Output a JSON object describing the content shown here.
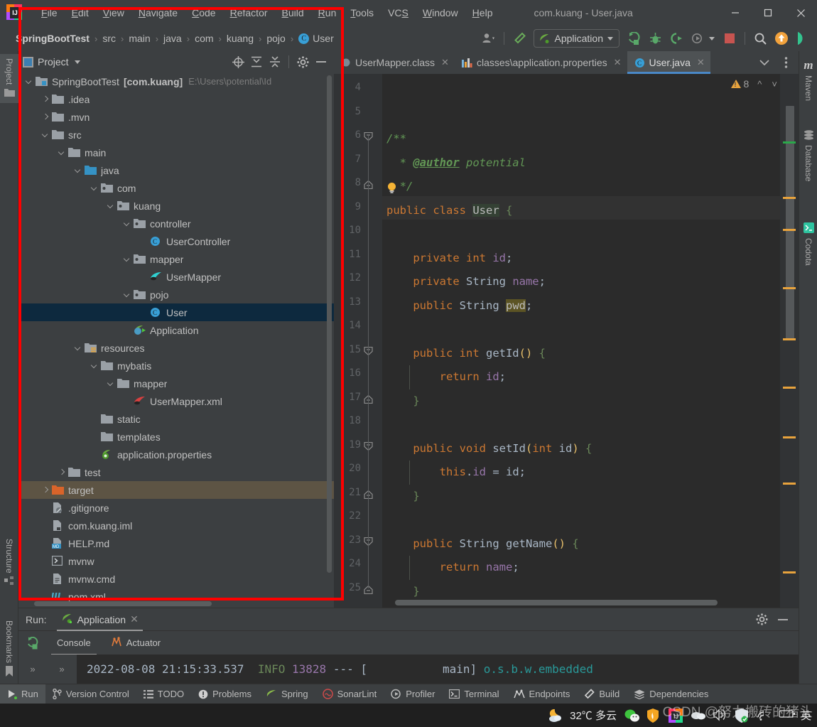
{
  "titlebar": {
    "menus": [
      "File",
      "Edit",
      "View",
      "Navigate",
      "Code",
      "Refactor",
      "Build",
      "Run",
      "Tools",
      "VCS",
      "Window",
      "Help"
    ],
    "window_title": "com.kuang - User.java",
    "minimize": "–",
    "maximize": "□",
    "close": "✕"
  },
  "navbar": {
    "crumbs": [
      "SpringBootTest",
      "src",
      "main",
      "java",
      "com",
      "kuang",
      "pojo"
    ],
    "leaf": "User",
    "separator": "›",
    "run_config": "Application"
  },
  "left_strip": {
    "project": "Project",
    "structure": "Structure",
    "bookmarks": "Bookmarks"
  },
  "right_strip": {
    "maven": "Maven",
    "database": "Database",
    "codota": "Codota"
  },
  "project_panel": {
    "title": "Project",
    "tree": [
      {
        "label": "SpringBootTest",
        "bold_suffix": "[com.kuang]",
        "path": "E:\\Users\\potential\\Id",
        "depth": 0,
        "arrow": "down",
        "icon": "module-folder",
        "state": "normal"
      },
      {
        "label": ".idea",
        "depth": 1,
        "arrow": "right",
        "icon": "folder",
        "state": "normal"
      },
      {
        "label": ".mvn",
        "depth": 1,
        "arrow": "right",
        "icon": "folder",
        "state": "normal"
      },
      {
        "label": "src",
        "depth": 1,
        "arrow": "down",
        "icon": "folder",
        "state": "normal"
      },
      {
        "label": "main",
        "depth": 2,
        "arrow": "down",
        "icon": "folder",
        "state": "normal"
      },
      {
        "label": "java",
        "depth": 3,
        "arrow": "down",
        "icon": "source-folder",
        "state": "normal"
      },
      {
        "label": "com",
        "depth": 4,
        "arrow": "down",
        "icon": "package",
        "state": "normal"
      },
      {
        "label": "kuang",
        "depth": 5,
        "arrow": "down",
        "icon": "package",
        "state": "normal"
      },
      {
        "label": "controller",
        "depth": 6,
        "arrow": "down",
        "icon": "package",
        "state": "normal"
      },
      {
        "label": "UserController",
        "depth": 7,
        "arrow": "none",
        "icon": "class",
        "state": "normal"
      },
      {
        "label": "mapper",
        "depth": 6,
        "arrow": "down",
        "icon": "package",
        "state": "normal"
      },
      {
        "label": "UserMapper",
        "depth": 7,
        "arrow": "none",
        "icon": "mybatis",
        "state": "normal"
      },
      {
        "label": "pojo",
        "depth": 6,
        "arrow": "down",
        "icon": "package",
        "state": "normal"
      },
      {
        "label": "User",
        "depth": 7,
        "arrow": "none",
        "icon": "class",
        "state": "selected"
      },
      {
        "label": "Application",
        "depth": 6,
        "arrow": "none",
        "icon": "spring-run",
        "state": "normal"
      },
      {
        "label": "resources",
        "depth": 3,
        "arrow": "down",
        "icon": "resources-folder",
        "state": "normal"
      },
      {
        "label": "mybatis",
        "depth": 4,
        "arrow": "down",
        "icon": "folder",
        "state": "normal"
      },
      {
        "label": "mapper",
        "depth": 5,
        "arrow": "down",
        "icon": "folder",
        "state": "normal"
      },
      {
        "label": "UserMapper.xml",
        "depth": 6,
        "arrow": "none",
        "icon": "mybatis-xml",
        "state": "normal"
      },
      {
        "label": "static",
        "depth": 4,
        "arrow": "none",
        "icon": "folder",
        "state": "normal"
      },
      {
        "label": "templates",
        "depth": 4,
        "arrow": "none",
        "icon": "folder",
        "state": "normal"
      },
      {
        "label": "application.properties",
        "depth": 4,
        "arrow": "none",
        "icon": "spring-props",
        "state": "normal"
      },
      {
        "label": "test",
        "depth": 2,
        "arrow": "right",
        "icon": "folder",
        "state": "normal"
      },
      {
        "label": "target",
        "depth": 1,
        "arrow": "right",
        "icon": "excluded-folder",
        "state": "target"
      },
      {
        "label": ".gitignore",
        "depth": 1,
        "arrow": "none",
        "icon": "gitignore",
        "state": "normal"
      },
      {
        "label": "com.kuang.iml",
        "depth": 1,
        "arrow": "none",
        "icon": "iml",
        "state": "normal"
      },
      {
        "label": "HELP.md",
        "depth": 1,
        "arrow": "none",
        "icon": "markdown",
        "state": "normal"
      },
      {
        "label": "mvnw",
        "depth": 1,
        "arrow": "none",
        "icon": "shell",
        "state": "normal"
      },
      {
        "label": "mvnw.cmd",
        "depth": 1,
        "arrow": "none",
        "icon": "text",
        "state": "normal"
      },
      {
        "label": "pom.xml",
        "depth": 1,
        "arrow": "none",
        "icon": "maven-pom",
        "state": "normal"
      }
    ]
  },
  "editor": {
    "tabs": [
      {
        "label": "UserMapper.class",
        "icon": "class-file",
        "active": false
      },
      {
        "label": "classes\\application.properties",
        "icon": "properties-file",
        "active": false
      },
      {
        "label": "User.java",
        "icon": "java-class",
        "active": true
      }
    ],
    "warning_count": "8",
    "lines": [
      {
        "no": "4",
        "tokens": []
      },
      {
        "no": "5",
        "tokens": []
      },
      {
        "no": "6",
        "tokens": [
          {
            "t": "/**",
            "c": "cm"
          }
        ],
        "fold": "open"
      },
      {
        "no": "7",
        "tokens": [
          {
            "t": "  * ",
            "c": "cm"
          },
          {
            "t": "@author",
            "c": "cmtag"
          },
          {
            "t": " potential",
            "c": "cm"
          }
        ]
      },
      {
        "no": "8",
        "tokens": [
          {
            "t": "  */",
            "c": "cm"
          }
        ],
        "fold": "end",
        "bulb": true
      },
      {
        "no": "9",
        "tokens": [
          {
            "t": "public ",
            "c": "k"
          },
          {
            "t": "class ",
            "c": "k"
          },
          {
            "t": "User",
            "c": "sel-ident"
          },
          {
            "t": " {",
            "c": "brc"
          }
        ],
        "highlight": true
      },
      {
        "no": "10",
        "tokens": []
      },
      {
        "no": "11",
        "tokens": [
          {
            "t": "    ",
            "c": "pun"
          },
          {
            "t": "private int ",
            "c": "k"
          },
          {
            "t": "id",
            "c": "fld"
          },
          {
            "t": ";",
            "c": "pun"
          }
        ]
      },
      {
        "no": "12",
        "tokens": [
          {
            "t": "    ",
            "c": "pun"
          },
          {
            "t": "private ",
            "c": "k"
          },
          {
            "t": "String ",
            "c": "typ"
          },
          {
            "t": "name",
            "c": "fld"
          },
          {
            "t": ";",
            "c": "pun"
          }
        ]
      },
      {
        "no": "13",
        "tokens": [
          {
            "t": "    ",
            "c": "pun"
          },
          {
            "t": "public ",
            "c": "k"
          },
          {
            "t": "String ",
            "c": "typ"
          },
          {
            "t": "pwd",
            "c": "sel-pwd"
          },
          {
            "t": ";",
            "c": "pun"
          }
        ]
      },
      {
        "no": "14",
        "tokens": []
      },
      {
        "no": "15",
        "tokens": [
          {
            "t": "    ",
            "c": "pun"
          },
          {
            "t": "public int ",
            "c": "k"
          },
          {
            "t": "getId",
            "c": "typ"
          },
          {
            "t": "()",
            "c": "par"
          },
          {
            "t": " {",
            "c": "brc"
          }
        ],
        "fold": "open"
      },
      {
        "no": "16",
        "tokens": [
          {
            "t": "        ",
            "c": "pun"
          },
          {
            "t": "return ",
            "c": "k"
          },
          {
            "t": "id",
            "c": "fld"
          },
          {
            "t": ";",
            "c": "pun"
          }
        ]
      },
      {
        "no": "17",
        "tokens": [
          {
            "t": "    ",
            "c": "pun"
          },
          {
            "t": "}",
            "c": "brc"
          }
        ],
        "fold": "end"
      },
      {
        "no": "18",
        "tokens": []
      },
      {
        "no": "19",
        "tokens": [
          {
            "t": "    ",
            "c": "pun"
          },
          {
            "t": "public void ",
            "c": "k"
          },
          {
            "t": "setId",
            "c": "typ"
          },
          {
            "t": "(",
            "c": "par"
          },
          {
            "t": "int ",
            "c": "k"
          },
          {
            "t": "id",
            "c": "prm"
          },
          {
            "t": ")",
            "c": "par"
          },
          {
            "t": " {",
            "c": "brc"
          }
        ],
        "fold": "open"
      },
      {
        "no": "20",
        "tokens": [
          {
            "t": "        ",
            "c": "pun"
          },
          {
            "t": "this",
            "c": "k"
          },
          {
            "t": ".",
            "c": "pun"
          },
          {
            "t": "id",
            "c": "fld"
          },
          {
            "t": " = ",
            "c": "pun"
          },
          {
            "t": "id",
            "c": "prm"
          },
          {
            "t": ";",
            "c": "pun"
          }
        ]
      },
      {
        "no": "21",
        "tokens": [
          {
            "t": "    ",
            "c": "pun"
          },
          {
            "t": "}",
            "c": "brc"
          }
        ],
        "fold": "end"
      },
      {
        "no": "22",
        "tokens": []
      },
      {
        "no": "23",
        "tokens": [
          {
            "t": "    ",
            "c": "pun"
          },
          {
            "t": "public ",
            "c": "k"
          },
          {
            "t": "String ",
            "c": "typ"
          },
          {
            "t": "getName",
            "c": "typ"
          },
          {
            "t": "()",
            "c": "par"
          },
          {
            "t": " {",
            "c": "brc"
          }
        ],
        "fold": "open"
      },
      {
        "no": "24",
        "tokens": [
          {
            "t": "        ",
            "c": "pun"
          },
          {
            "t": "return ",
            "c": "k"
          },
          {
            "t": "name",
            "c": "fld"
          },
          {
            "t": ";",
            "c": "pun"
          }
        ]
      },
      {
        "no": "25",
        "tokens": [
          {
            "t": "    ",
            "c": "pun"
          },
          {
            "t": "}",
            "c": "brc"
          }
        ],
        "fold": "end"
      }
    ]
  },
  "run_panel": {
    "run_label": "Run:",
    "config_tab": "Application",
    "tabs": [
      {
        "label": "Console",
        "active": true
      },
      {
        "label": "Actuator",
        "active": false
      }
    ],
    "console_line": {
      "timestamp": "2022-08-08 21:15:33.537",
      "level": "INFO",
      "pid": "13828",
      "dashes": "---",
      "bracket_open": "[",
      "thread": "main]",
      "logger": "o.s.b.w.embedded"
    }
  },
  "bottom_bar": {
    "items": [
      {
        "label": "Run",
        "icon": "run-icon",
        "active": true
      },
      {
        "label": "Version Control",
        "icon": "branch-icon",
        "active": false
      },
      {
        "label": "TODO",
        "icon": "list-icon",
        "active": false
      },
      {
        "label": "Problems",
        "icon": "exclamation-icon",
        "active": false
      },
      {
        "label": "Spring",
        "icon": "leaf-icon",
        "active": false
      },
      {
        "label": "SonarLint",
        "icon": "sonar-icon",
        "active": false
      },
      {
        "label": "Profiler",
        "icon": "gauge-icon",
        "active": false
      },
      {
        "label": "Terminal",
        "icon": "terminal-icon",
        "active": false
      },
      {
        "label": "Endpoints",
        "icon": "endpoints-icon",
        "active": false
      },
      {
        "label": "Build",
        "icon": "hammer-icon",
        "active": false
      },
      {
        "label": "Dependencies",
        "icon": "layers-icon",
        "active": false
      }
    ]
  },
  "taskbar": {
    "weather": "32℃ 多云",
    "ime": "英",
    "watermark": "CSDN @努力搬砖的猪头"
  },
  "colors": {
    "accent_blue": "#4a88c7",
    "selection": "#0d293e",
    "warning": "#e8a33d",
    "annotation_red": "#fe0000",
    "keyword": "#cc7832",
    "comment": "#629755",
    "field": "#9876aa",
    "brace": "#6a8759"
  }
}
